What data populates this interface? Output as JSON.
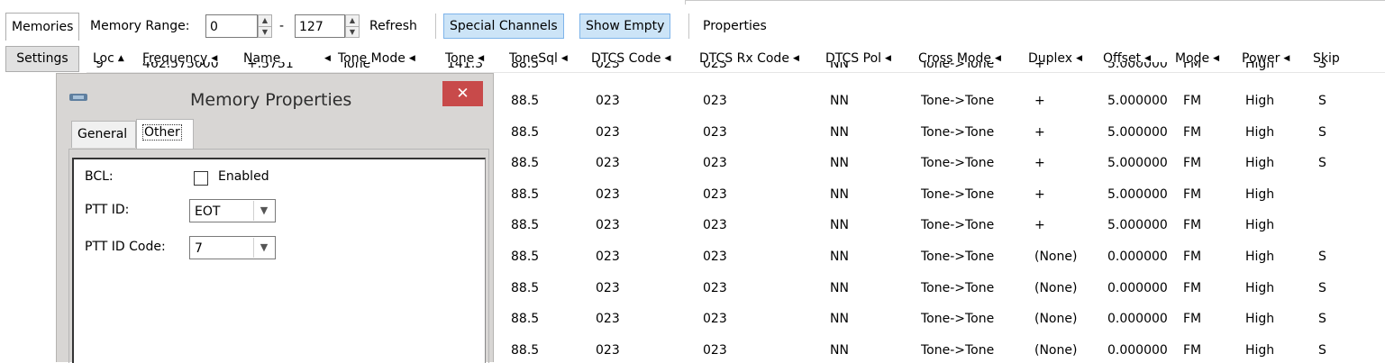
{
  "toolbar": {
    "memories_tab": "Memories",
    "memory_range_label": "Memory Range:",
    "range_start": "0",
    "range_dash": "-",
    "range_end": "127",
    "refresh": "Refresh",
    "special_channels": "Special Channels",
    "show_empty": "Show Empty",
    "properties": "Properties"
  },
  "settings_tab": "Settings",
  "columns": [
    "Loc",
    "Frequency",
    "Name",
    "Tone Mode",
    "Tone",
    "ToneSql",
    "DTCS Code",
    "DTCS Rx Code",
    "DTCS Pol",
    "Cross Mode",
    "Duplex",
    "Offset",
    "Mode",
    "Power",
    "Skip"
  ],
  "partial_row": {
    "loc": "9",
    "frequency": "462.575000",
    "name": "+.5751",
    "tone_mode": "Tone",
    "tone": "141.3",
    "tonesql": "88.5",
    "dtcs_code": "023",
    "dtcs_rx_code": "023",
    "dtcs_pol": "NN",
    "cross_mode": "Tone->Tone",
    "duplex": "+",
    "offset": "5.000000",
    "mode": "FM",
    "power": "High",
    "skip": "S"
  },
  "rows": [
    {
      "tonesql": "88.5",
      "dtcs_code": "023",
      "dtcs_rx_code": "023",
      "dtcs_pol": "NN",
      "cross_mode": "Tone->Tone",
      "duplex": "+",
      "offset": "5.000000",
      "mode": "FM",
      "power": "High",
      "skip": "S"
    },
    {
      "tonesql": "88.5",
      "dtcs_code": "023",
      "dtcs_rx_code": "023",
      "dtcs_pol": "NN",
      "cross_mode": "Tone->Tone",
      "duplex": "+",
      "offset": "5.000000",
      "mode": "FM",
      "power": "High",
      "skip": "S"
    },
    {
      "tonesql": "88.5",
      "dtcs_code": "023",
      "dtcs_rx_code": "023",
      "dtcs_pol": "NN",
      "cross_mode": "Tone->Tone",
      "duplex": "+",
      "offset": "5.000000",
      "mode": "FM",
      "power": "High",
      "skip": "S"
    },
    {
      "tonesql": "88.5",
      "dtcs_code": "023",
      "dtcs_rx_code": "023",
      "dtcs_pol": "NN",
      "cross_mode": "Tone->Tone",
      "duplex": "+",
      "offset": "5.000000",
      "mode": "FM",
      "power": "High",
      "skip": ""
    },
    {
      "tonesql": "88.5",
      "dtcs_code": "023",
      "dtcs_rx_code": "023",
      "dtcs_pol": "NN",
      "cross_mode": "Tone->Tone",
      "duplex": "+",
      "offset": "5.000000",
      "mode": "FM",
      "power": "High",
      "skip": ""
    },
    {
      "tonesql": "88.5",
      "dtcs_code": "023",
      "dtcs_rx_code": "023",
      "dtcs_pol": "NN",
      "cross_mode": "Tone->Tone",
      "duplex": "(None)",
      "offset": "0.000000",
      "mode": "FM",
      "power": "High",
      "skip": "S"
    },
    {
      "tonesql": "88.5",
      "dtcs_code": "023",
      "dtcs_rx_code": "023",
      "dtcs_pol": "NN",
      "cross_mode": "Tone->Tone",
      "duplex": "(None)",
      "offset": "0.000000",
      "mode": "FM",
      "power": "High",
      "skip": "S"
    },
    {
      "tonesql": "88.5",
      "dtcs_code": "023",
      "dtcs_rx_code": "023",
      "dtcs_pol": "NN",
      "cross_mode": "Tone->Tone",
      "duplex": "(None)",
      "offset": "0.000000",
      "mode": "FM",
      "power": "High",
      "skip": "S"
    },
    {
      "tonesql": "88.5",
      "dtcs_code": "023",
      "dtcs_rx_code": "023",
      "dtcs_pol": "NN",
      "cross_mode": "Tone->Tone",
      "duplex": "(None)",
      "offset": "0.000000",
      "mode": "FM",
      "power": "High",
      "skip": "S"
    }
  ],
  "dialog": {
    "title": "Memory Properties",
    "close_glyph": "✕",
    "tabs": [
      "General",
      "Other"
    ],
    "active_tab": "Other",
    "bcl_label": "BCL:",
    "bcl_checkbox_label": "Enabled",
    "bcl_checked": false,
    "ptt_id_label": "PTT ID:",
    "ptt_id_value": "EOT",
    "ptt_id_code_label": "PTT ID Code:",
    "ptt_id_code_value": "7"
  },
  "colors": {
    "toggle_bg": "#cce4f7",
    "toggle_border": "#7eb4ea",
    "close_bg": "#c84a4a",
    "dialog_bg": "#d8d6d4"
  }
}
